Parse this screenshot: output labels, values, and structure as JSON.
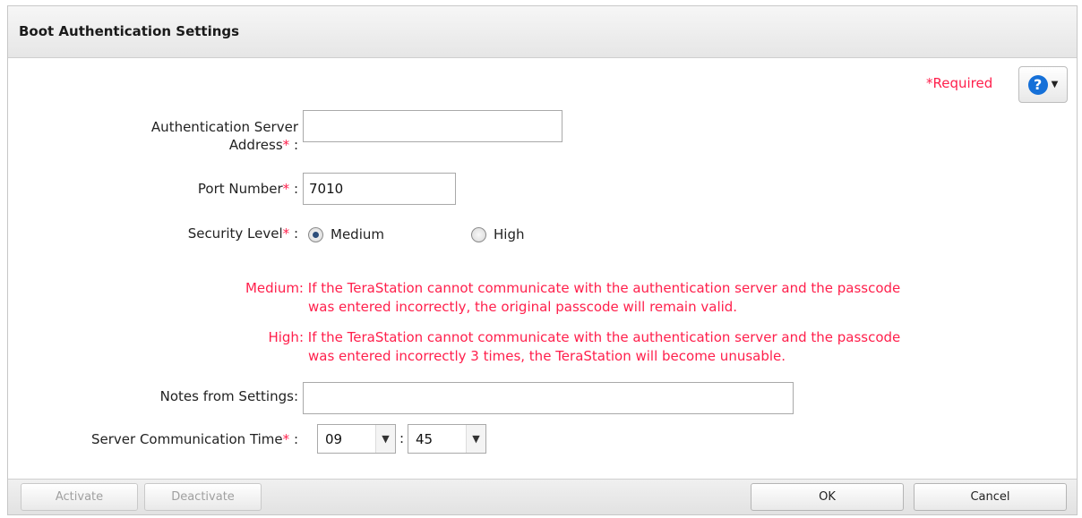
{
  "dialog": {
    "title": "Boot Authentication Settings",
    "required_label": "*Required",
    "help_icon": "question-circle-icon"
  },
  "form": {
    "auth_server": {
      "label_line1": "Authentication Server",
      "label_line2": "Address",
      "star": "*",
      "colon": ":",
      "value": ""
    },
    "port": {
      "label": "Port Number",
      "star": "*",
      "colon": ":",
      "value": "7010"
    },
    "security": {
      "label": "Security Level",
      "star": "*",
      "colon": ":",
      "options": [
        "Medium",
        "High"
      ],
      "selected": "Medium"
    },
    "desc_medium": {
      "key": "Medium:",
      "line1": "If the TeraStation cannot communicate with the authentication server and the passcode",
      "line2": "was entered incorrectly, the original passcode will remain valid."
    },
    "desc_high": {
      "key": "High:",
      "line1": "If the TeraStation cannot communicate with the authentication server and the passcode",
      "line2": "was entered incorrectly 3 times, the TeraStation will become unusable."
    },
    "notes": {
      "label": "Notes from Settings:",
      "value": ""
    },
    "time": {
      "label": "Server Communication Time",
      "star": "*",
      "colon": ":",
      "hour": "09",
      "sep": ":",
      "minute": "45"
    }
  },
  "footer": {
    "activate": "Activate",
    "deactivate": "Deactivate",
    "ok": "OK",
    "cancel": "Cancel"
  },
  "colors": {
    "accent_red": "#ff1f4b",
    "help_blue": "#1570d8"
  }
}
